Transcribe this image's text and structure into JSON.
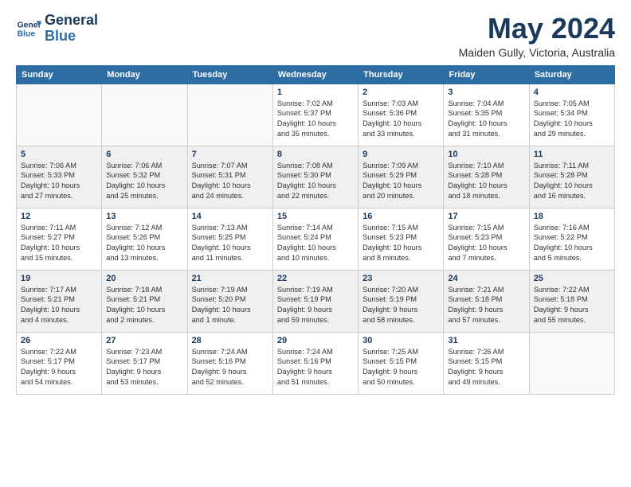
{
  "logo": {
    "line1": "General",
    "line2": "Blue"
  },
  "title": "May 2024",
  "subtitle": "Maiden Gully, Victoria, Australia",
  "weekdays": [
    "Sunday",
    "Monday",
    "Tuesday",
    "Wednesday",
    "Thursday",
    "Friday",
    "Saturday"
  ],
  "weeks": [
    [
      {
        "day": "",
        "detail": ""
      },
      {
        "day": "",
        "detail": ""
      },
      {
        "day": "",
        "detail": ""
      },
      {
        "day": "1",
        "detail": "Sunrise: 7:02 AM\nSunset: 5:37 PM\nDaylight: 10 hours\nand 35 minutes."
      },
      {
        "day": "2",
        "detail": "Sunrise: 7:03 AM\nSunset: 5:36 PM\nDaylight: 10 hours\nand 33 minutes."
      },
      {
        "day": "3",
        "detail": "Sunrise: 7:04 AM\nSunset: 5:35 PM\nDaylight: 10 hours\nand 31 minutes."
      },
      {
        "day": "4",
        "detail": "Sunrise: 7:05 AM\nSunset: 5:34 PM\nDaylight: 10 hours\nand 29 minutes."
      }
    ],
    [
      {
        "day": "5",
        "detail": "Sunrise: 7:06 AM\nSunset: 5:33 PM\nDaylight: 10 hours\nand 27 minutes."
      },
      {
        "day": "6",
        "detail": "Sunrise: 7:06 AM\nSunset: 5:32 PM\nDaylight: 10 hours\nand 25 minutes."
      },
      {
        "day": "7",
        "detail": "Sunrise: 7:07 AM\nSunset: 5:31 PM\nDaylight: 10 hours\nand 24 minutes."
      },
      {
        "day": "8",
        "detail": "Sunrise: 7:08 AM\nSunset: 5:30 PM\nDaylight: 10 hours\nand 22 minutes."
      },
      {
        "day": "9",
        "detail": "Sunrise: 7:09 AM\nSunset: 5:29 PM\nDaylight: 10 hours\nand 20 minutes."
      },
      {
        "day": "10",
        "detail": "Sunrise: 7:10 AM\nSunset: 5:28 PM\nDaylight: 10 hours\nand 18 minutes."
      },
      {
        "day": "11",
        "detail": "Sunrise: 7:11 AM\nSunset: 5:28 PM\nDaylight: 10 hours\nand 16 minutes."
      }
    ],
    [
      {
        "day": "12",
        "detail": "Sunrise: 7:11 AM\nSunset: 5:27 PM\nDaylight: 10 hours\nand 15 minutes."
      },
      {
        "day": "13",
        "detail": "Sunrise: 7:12 AM\nSunset: 5:26 PM\nDaylight: 10 hours\nand 13 minutes."
      },
      {
        "day": "14",
        "detail": "Sunrise: 7:13 AM\nSunset: 5:25 PM\nDaylight: 10 hours\nand 11 minutes."
      },
      {
        "day": "15",
        "detail": "Sunrise: 7:14 AM\nSunset: 5:24 PM\nDaylight: 10 hours\nand 10 minutes."
      },
      {
        "day": "16",
        "detail": "Sunrise: 7:15 AM\nSunset: 5:23 PM\nDaylight: 10 hours\nand 8 minutes."
      },
      {
        "day": "17",
        "detail": "Sunrise: 7:15 AM\nSunset: 5:23 PM\nDaylight: 10 hours\nand 7 minutes."
      },
      {
        "day": "18",
        "detail": "Sunrise: 7:16 AM\nSunset: 5:22 PM\nDaylight: 10 hours\nand 5 minutes."
      }
    ],
    [
      {
        "day": "19",
        "detail": "Sunrise: 7:17 AM\nSunset: 5:21 PM\nDaylight: 10 hours\nand 4 minutes."
      },
      {
        "day": "20",
        "detail": "Sunrise: 7:18 AM\nSunset: 5:21 PM\nDaylight: 10 hours\nand 2 minutes."
      },
      {
        "day": "21",
        "detail": "Sunrise: 7:19 AM\nSunset: 5:20 PM\nDaylight: 10 hours\nand 1 minute."
      },
      {
        "day": "22",
        "detail": "Sunrise: 7:19 AM\nSunset: 5:19 PM\nDaylight: 9 hours\nand 59 minutes."
      },
      {
        "day": "23",
        "detail": "Sunrise: 7:20 AM\nSunset: 5:19 PM\nDaylight: 9 hours\nand 58 minutes."
      },
      {
        "day": "24",
        "detail": "Sunrise: 7:21 AM\nSunset: 5:18 PM\nDaylight: 9 hours\nand 57 minutes."
      },
      {
        "day": "25",
        "detail": "Sunrise: 7:22 AM\nSunset: 5:18 PM\nDaylight: 9 hours\nand 55 minutes."
      }
    ],
    [
      {
        "day": "26",
        "detail": "Sunrise: 7:22 AM\nSunset: 5:17 PM\nDaylight: 9 hours\nand 54 minutes."
      },
      {
        "day": "27",
        "detail": "Sunrise: 7:23 AM\nSunset: 5:17 PM\nDaylight: 9 hours\nand 53 minutes."
      },
      {
        "day": "28",
        "detail": "Sunrise: 7:24 AM\nSunset: 5:16 PM\nDaylight: 9 hours\nand 52 minutes."
      },
      {
        "day": "29",
        "detail": "Sunrise: 7:24 AM\nSunset: 5:16 PM\nDaylight: 9 hours\nand 51 minutes."
      },
      {
        "day": "30",
        "detail": "Sunrise: 7:25 AM\nSunset: 5:15 PM\nDaylight: 9 hours\nand 50 minutes."
      },
      {
        "day": "31",
        "detail": "Sunrise: 7:26 AM\nSunset: 5:15 PM\nDaylight: 9 hours\nand 49 minutes."
      },
      {
        "day": "",
        "detail": ""
      }
    ]
  ]
}
